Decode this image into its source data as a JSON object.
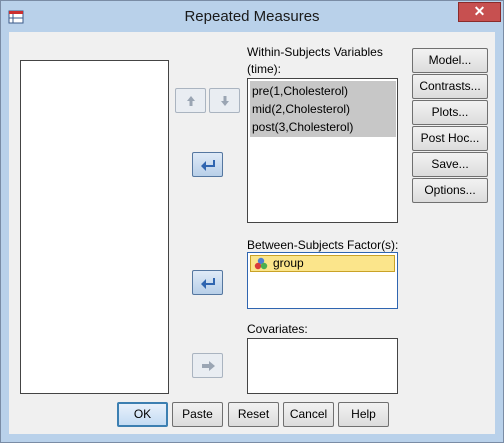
{
  "window": {
    "title": "Repeated Measures",
    "close_label": "✕"
  },
  "labels": {
    "within_subjects": "Within-Subjects Variables",
    "within_factor": "(time):",
    "between_subjects": "Between-Subjects Factor(s):",
    "covariates": "Covariates:"
  },
  "within_items": [
    "pre(1,Cholesterol)",
    "mid(2,Cholesterol)",
    "post(3,Cholesterol)"
  ],
  "between_items": [
    "group"
  ],
  "side_buttons": [
    "Model...",
    "Contrasts...",
    "Plots...",
    "Post Hoc...",
    "Save...",
    "Options..."
  ],
  "bottom_buttons": [
    "OK",
    "Paste",
    "Reset",
    "Cancel",
    "Help"
  ],
  "colors": {
    "accent": "#2f65b0",
    "selection": "#c7c7c7",
    "highlight": "#fbe58b"
  }
}
